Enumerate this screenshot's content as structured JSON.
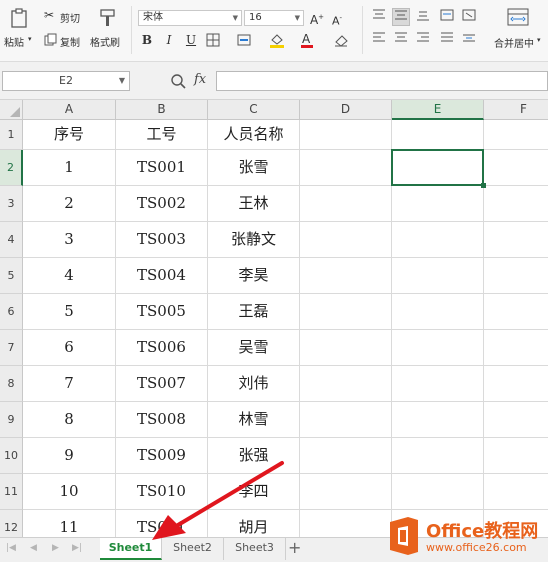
{
  "ribbon": {
    "paste_label": "粘贴",
    "cut_label": "剪切",
    "copy_label": "复制",
    "format_painter_label": "格式刷",
    "font_name": "宋体",
    "font_size": "16",
    "bold_label": "B",
    "italic_label": "I",
    "underline_label": "U",
    "merge_center_label": "合并居中"
  },
  "formula_bar": {
    "name_box": "E2",
    "fx_label": "fx"
  },
  "grid": {
    "columns": [
      "A",
      "B",
      "C",
      "D",
      "E",
      "F"
    ],
    "active_column": "E",
    "rows": [
      [
        "1",
        "序号",
        "工号",
        "人员名称"
      ],
      [
        "2",
        "1",
        "TS001",
        "张雪"
      ],
      [
        "3",
        "2",
        "TS002",
        "王林"
      ],
      [
        "4",
        "3",
        "TS003",
        "张静文"
      ],
      [
        "5",
        "4",
        "TS004",
        "李昊"
      ],
      [
        "6",
        "5",
        "TS005",
        "王磊"
      ],
      [
        "7",
        "6",
        "TS006",
        "吴雪"
      ],
      [
        "8",
        "7",
        "TS007",
        "刘伟"
      ],
      [
        "9",
        "8",
        "TS008",
        "林雪"
      ],
      [
        "10",
        "9",
        "TS009",
        "张强"
      ],
      [
        "11",
        "10",
        "TS010",
        "李四"
      ],
      [
        "12",
        "11",
        "TS011",
        "胡月"
      ]
    ],
    "active_row": "2"
  },
  "sheets": {
    "tabs": [
      "Sheet1",
      "Sheet2",
      "Sheet3"
    ],
    "active": "Sheet1",
    "add_label": "+"
  },
  "watermark": {
    "title": "Office教程网",
    "url": "www.office26.com"
  },
  "colors": {
    "accent_green": "#217346",
    "arrow_red": "#e0161e",
    "watermark_orange": "#e8621c"
  }
}
